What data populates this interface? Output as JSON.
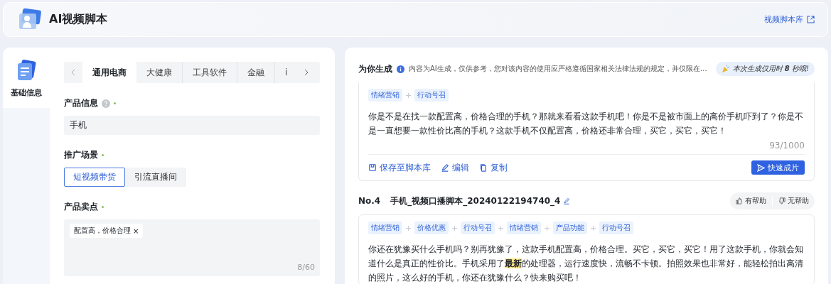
{
  "header": {
    "title": "AI视频脚本",
    "library_link": "视频脚本库"
  },
  "sidebar": {
    "items": [
      {
        "label": "基础信息",
        "selected": true
      }
    ]
  },
  "form": {
    "tabs": [
      {
        "label": "通用电商",
        "selected": true
      },
      {
        "label": "大健康",
        "selected": false
      },
      {
        "label": "工具软件",
        "selected": false
      },
      {
        "label": "金融",
        "selected": false
      },
      {
        "label": "i",
        "selected": false
      }
    ],
    "product_info": {
      "label": "产品信息",
      "required": true,
      "value": "手机"
    },
    "scene": {
      "label": "推广场景",
      "required": true,
      "options": [
        {
          "label": "短视频带货",
          "selected": true
        },
        {
          "label": "引流直播间",
          "selected": false
        }
      ]
    },
    "selling_points": {
      "label": "产品卖点",
      "required": true,
      "tags": [
        "配置高，价格合理"
      ],
      "remove": "×",
      "counter": "8/60"
    }
  },
  "results": {
    "title": "为你生成",
    "notice": "内容为AI生成，仅供参考，您对该内容的使用应严格遵循国家相关法律法规的规定，并仅限在…",
    "timing": "本次生成仅用时 **8** 秒哦!",
    "scripts": [
      {
        "tags": [
          "情绪营销",
          "行动号召"
        ],
        "segments": [
          {
            "text": "你是不是在找一款配置高，价格合理的手机？那就来看看这款手机吧！你是不是被市面上的高价手机吓到了？你是不是一直想要一款性价比高的手机？这款手机不仅配置高，价格还非常合理，买它，买它，买它！",
            "highlighted": false
          }
        ],
        "counter": "93/1000",
        "actions": [
          "保存至脚本库",
          "编辑",
          "复制"
        ],
        "primary": "快速成片"
      },
      {
        "number": "No.4",
        "name": "手机_视频口播脚本_20240122194740_4",
        "feedback": [
          "有帮助",
          "无帮助"
        ],
        "tags": [
          "情绪营销",
          "价格优惠",
          "行动号召",
          "情绪营销",
          "产品功能",
          "行动号召"
        ],
        "segments": [
          {
            "text": "你还在犹豫买什么手机吗？别再犹豫了，这款手机配置高，价格合理。买它，买它，买它！用了这款手机，你就会知道什么是真正的性价比。手机采用了",
            "highlighted": false
          },
          {
            "text": "最新",
            "highlighted": true
          },
          {
            "text": "的处理器，运行速度快，流畅不卡顿。拍照效果也非常好，能轻松拍出高清的照片，这么好的手机，你还在犹豫什么？快来购买吧！",
            "highlighted": false
          }
        ]
      }
    ]
  }
}
